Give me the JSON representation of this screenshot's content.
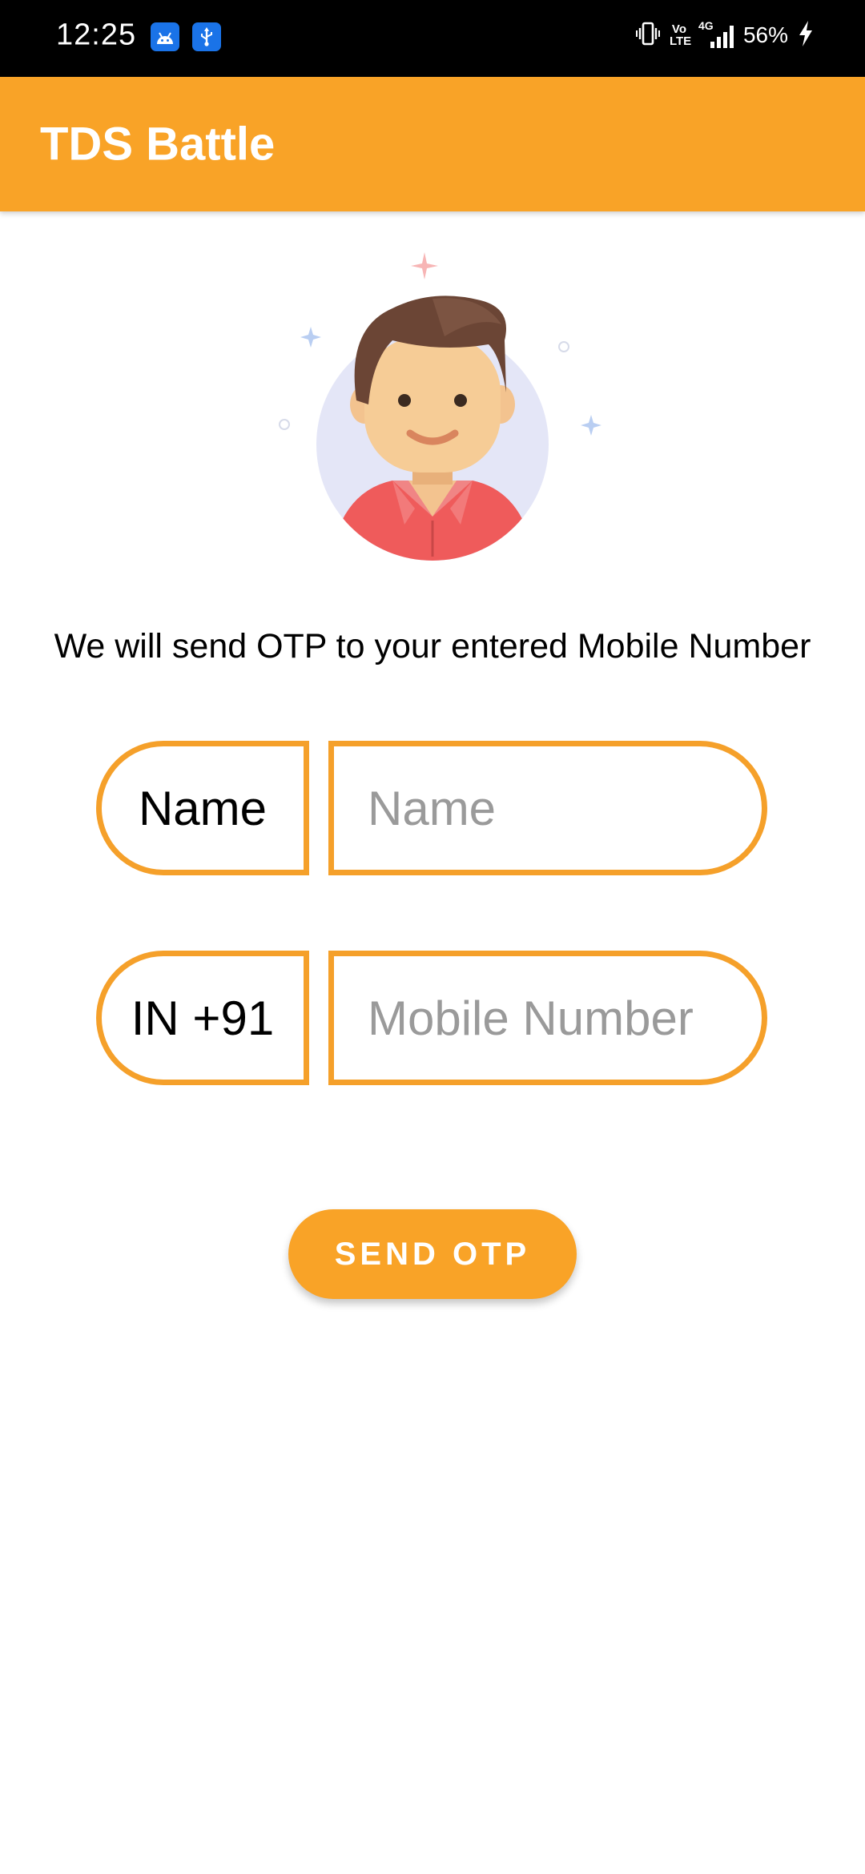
{
  "status_bar": {
    "time": "12:25",
    "volte": "Vo LTE",
    "network": "4G",
    "battery": "56%",
    "icons": [
      "android-icon",
      "usb-icon",
      "vibrate-icon",
      "volte-icon",
      "signal-icon",
      "charging-icon"
    ]
  },
  "app_bar": {
    "title": "TDS Battle",
    "color": "#F9A327"
  },
  "main": {
    "avatar_icon": "user-avatar-illustration",
    "info_text": "We will send OTP to your entered Mobile Number",
    "name_row": {
      "prefix_label": "Name",
      "placeholder": "Name"
    },
    "mobile_row": {
      "prefix_label": "IN +91",
      "placeholder": "Mobile Number"
    },
    "send_button_label": "SEND OTP",
    "accent_color": "#F5A02A"
  }
}
